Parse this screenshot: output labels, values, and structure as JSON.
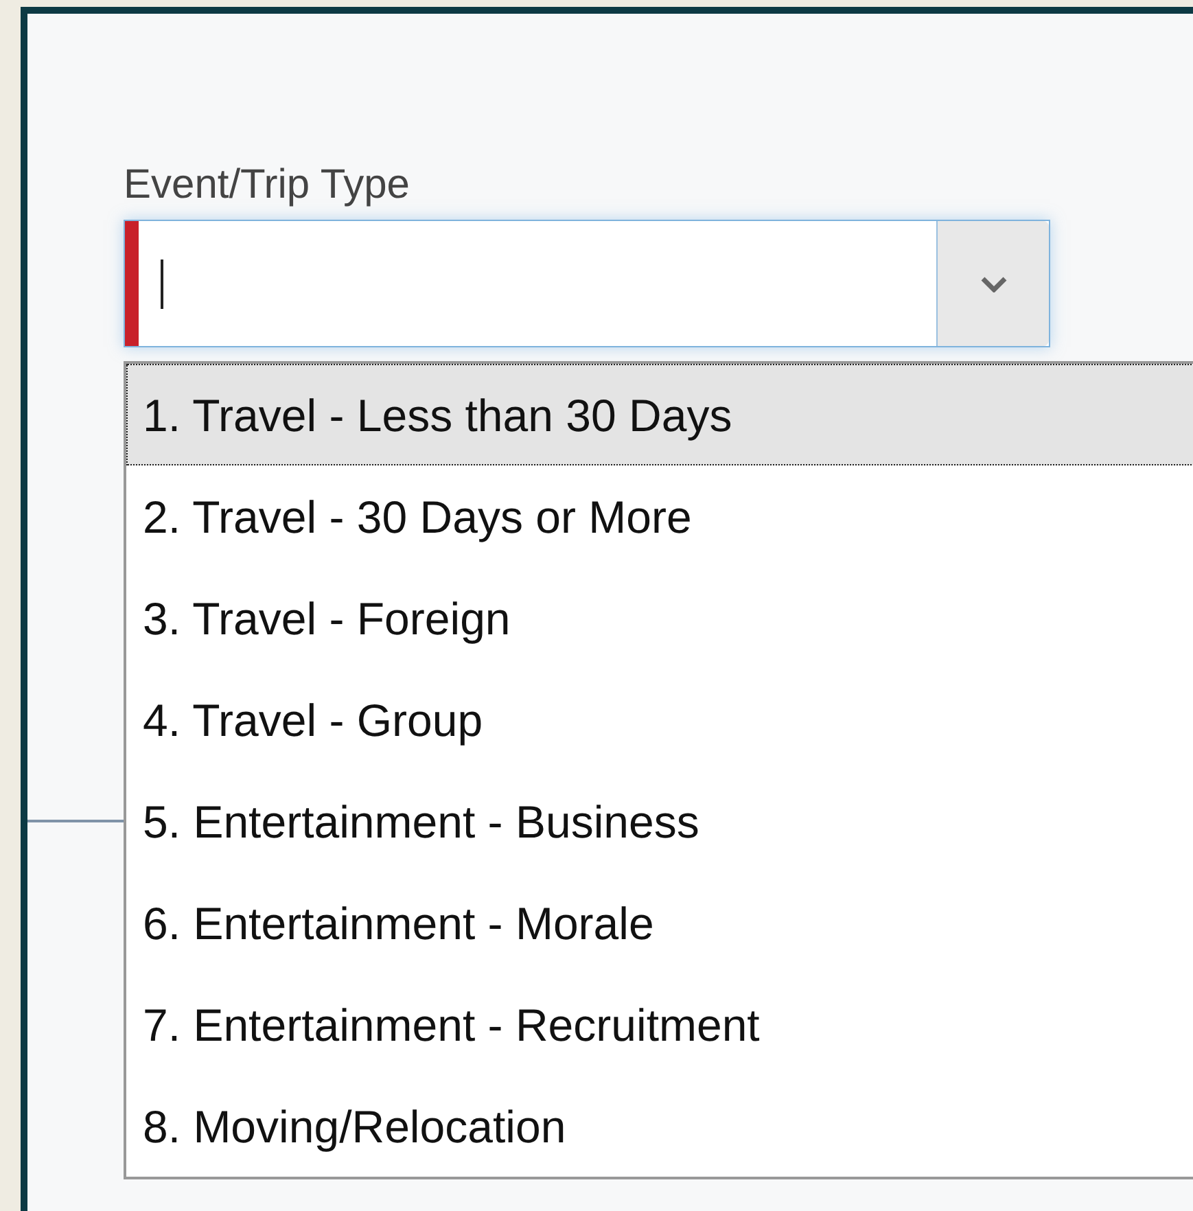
{
  "field": {
    "label": "Event/Trip Type",
    "required": true,
    "expanded": true,
    "options": [
      {
        "label": "1. Travel - Less than 30 Days",
        "selected": true
      },
      {
        "label": "2. Travel - 30 Days or More",
        "selected": false
      },
      {
        "label": "3. Travel - Foreign",
        "selected": false
      },
      {
        "label": "4. Travel - Group",
        "selected": false
      },
      {
        "label": "5. Entertainment - Business",
        "selected": false
      },
      {
        "label": "6. Entertainment - Morale",
        "selected": false
      },
      {
        "label": "7. Entertainment - Recruitment",
        "selected": false
      },
      {
        "label": "8. Moving/Relocation",
        "selected": false
      }
    ]
  }
}
